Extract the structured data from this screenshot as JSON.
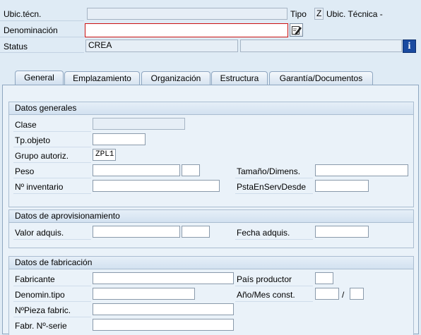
{
  "header": {
    "ubic_label": "Ubic.técn.",
    "ubic_value": "",
    "tipo_label": "Tipo",
    "tipo_value": "Z",
    "tipo_text": "Ubic. Técnica -",
    "denom_label": "Denominación",
    "denom_value": "",
    "status_label": "Status",
    "status_value": "CREA",
    "status_value2": ""
  },
  "tabs": [
    {
      "label": "General"
    },
    {
      "label": "Emplazamiento"
    },
    {
      "label": "Organización"
    },
    {
      "label": "Estructura"
    },
    {
      "label": "Garantía/Documentos"
    }
  ],
  "active_tab": "General",
  "general": {
    "title": "Datos generales",
    "clase_label": "Clase",
    "clase_value": "",
    "tpobjeto_label": "Tp.objeto",
    "tpobjeto_value": "",
    "grupo_label": "Grupo autoriz.",
    "grupo_value": "ZPL1",
    "peso_label": "Peso",
    "peso_value": "",
    "peso_unit": "",
    "tamano_label": "Tamaño/Dimens.",
    "tamano_value": "",
    "inventario_label": "Nº inventario",
    "inventario_value": "",
    "pstaenserv_label": "PstaEnServDesde",
    "pstaenserv_value": ""
  },
  "aprov": {
    "title": "Datos de aprovisionamiento",
    "valor_label": "Valor adquis.",
    "valor_value": "",
    "moneda_value": "",
    "fecha_label": "Fecha adquis.",
    "fecha_value": ""
  },
  "fabric": {
    "title": "Datos de fabricación",
    "fabricante_label": "Fabricante",
    "fabricante_value": "",
    "pais_label": "País productor",
    "pais_value": "",
    "denomtipo_label": "Denomin.tipo",
    "denomtipo_value": "",
    "anomes_label": "Año/Mes const.",
    "ano_value": "",
    "slash": "/",
    "mes_value": "",
    "pieza_label": "NºPieza fabric.",
    "pieza_value": "",
    "serie_label": "Fabr. Nº-serie",
    "serie_value": ""
  },
  "icons": {
    "edit": "edit-long-text-icon",
    "info": "information-icon"
  }
}
